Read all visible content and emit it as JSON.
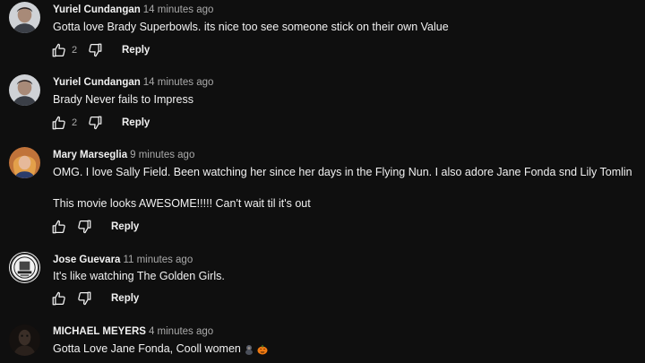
{
  "comments": [
    {
      "author": "Yuriel Cundangan",
      "time": "14 minutes ago",
      "text": "Gotta love Brady Superbowls. its nice too see someone stick on their own Value",
      "likes": "2",
      "reply": "Reply"
    },
    {
      "author": "Yuriel Cundangan",
      "time": "14 minutes ago",
      "text": "Brady Never fails to Impress",
      "likes": "2",
      "reply": "Reply"
    },
    {
      "author": "Mary Marseglia",
      "time": "9 minutes ago",
      "text_line1": "OMG.  I love Sally Field.  Been watching her since her days in the Flying Nun.  I also adore Jane Fonda snd Lily Tomlin",
      "text_line2": "This movie looks AWESOME!!!!! Can't wait til it's out",
      "reply": "Reply"
    },
    {
      "author": "Jose Guevara",
      "time": "11 minutes ago",
      "text": "It's like watching The Golden Girls.",
      "reply": "Reply"
    },
    {
      "author": "MICHAEL MEYERS",
      "time": "4 minutes ago",
      "text": "Gotta Love Jane Fonda, Cooll women",
      "emojis": [
        "gorilla-emoji",
        "pumpkin-emoji"
      ]
    }
  ],
  "icons": {
    "like": "thumbs-up-icon",
    "dislike": "thumbs-down-icon"
  },
  "colors": {
    "background": "#0f0f0f",
    "text": "#f1f1f1",
    "secondary": "#aaaaaa"
  }
}
